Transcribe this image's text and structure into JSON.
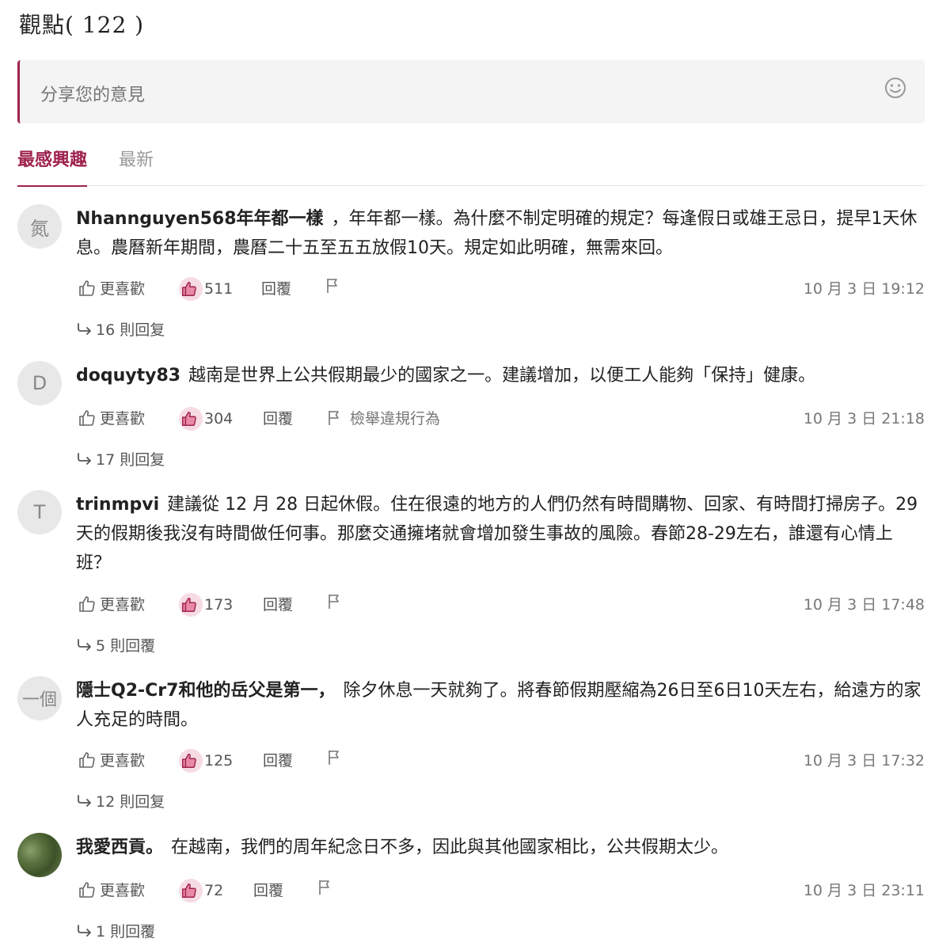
{
  "header": {
    "title": "觀點( 122 )"
  },
  "composer": {
    "placeholder": "分享您的意見"
  },
  "tabs": [
    {
      "label": "最感興趣",
      "active": true
    },
    {
      "label": "最新",
      "active": false
    }
  ],
  "colors": {
    "accent": "#9f224e",
    "like_bg": "#f6dbe3"
  },
  "comments": [
    {
      "avatar_text": "氮",
      "username": "Nhannguyen568年年都一樣",
      "text": "，年年都一樣。為什麼不制定明確的規定？每逢假日或雄王忌日，提早1天休息。農曆新年期間，農曆二十五至五五放假10天。規定如此明確，無需來回。",
      "like_label": "更喜歡",
      "likes": "511",
      "reply_label": "回覆",
      "report_label": "",
      "time": "10 月 3 日 19:12",
      "replies": "16 則回复"
    },
    {
      "avatar_text": "D",
      "username": "doquyty83",
      "text": "越南是世界上公共假期最少的國家之一。建議增加，以便工人能夠「保持」健康。",
      "like_label": "更喜歡",
      "likes": "304",
      "reply_label": "回覆",
      "report_label": "檢舉違規行為",
      "time": "10 月 3 日 21:18",
      "replies": "17 則回复"
    },
    {
      "avatar_text": "T",
      "username": "trinmpvi",
      "text": "建議從 12 月 28 日起休假。住在很遠的地方的人們仍然有時間購物、回家、有時間打掃房子。29天的假期後我沒有時間做任何事。那麼交通擁堵就會增加發生事故的風險。春節28-29左右，誰還有心情上班？",
      "like_label": "更喜歡",
      "likes": "173",
      "reply_label": "回覆",
      "report_label": "",
      "time": "10 月 3 日 17:48",
      "replies": "5 則回覆"
    },
    {
      "avatar_text": "一個",
      "username": "隱士Q2-Cr7和他的岳父是第一，",
      "text": "除夕休息一天就夠了。將春節假期壓縮為26日至6日10天左右，給遠方的家人充足的時間。",
      "like_label": "更喜歡",
      "likes": "125",
      "reply_label": "回覆",
      "report_label": "",
      "time": "10 月 3 日 17:32",
      "replies": "12 則回复"
    },
    {
      "avatar_text": "",
      "username": "我愛西貢。",
      "text": "在越南，我們的周年紀念日不多，因此與其他國家相比，公共假期太少。",
      "like_label": "更喜歡",
      "likes": "72",
      "reply_label": "回覆",
      "report_label": "",
      "time": "10 月 3 日 23:11",
      "replies": "1 則回覆"
    }
  ]
}
